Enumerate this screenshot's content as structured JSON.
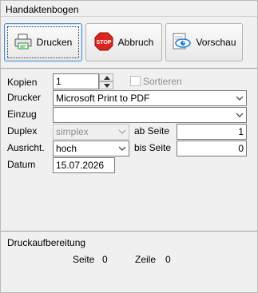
{
  "window": {
    "title": "Handaktenbogen"
  },
  "toolbar": {
    "print_label": "Drucken",
    "abort_label": "Abbruch",
    "stop_text": "STOP",
    "preview_label": "Vorschau"
  },
  "form": {
    "copies_label": "Kopien",
    "copies_value": "1",
    "sort_label": "Sortieren",
    "printer_label": "Drucker",
    "printer_value": "Microsoft Print to PDF",
    "tray_label": "Einzug",
    "tray_value": "",
    "duplex_label": "Duplex",
    "duplex_value": "simplex",
    "from_page_label": "ab Seite",
    "from_page_value": "1",
    "orientation_label": "Ausricht.",
    "orientation_value": "hoch",
    "to_page_label": "bis Seite",
    "to_page_value": "0",
    "date_label": "Datum",
    "date_value": "15.07.2026"
  },
  "status": {
    "heading": "Druckaufbereitung",
    "page_label": "Seite",
    "page_value": "0",
    "line_label": "Zeile",
    "line_value": "0"
  },
  "colors": {
    "accent_focus": "#4a8fd6",
    "stop_red": "#d9251d",
    "preview_blue": "#1f7fd4",
    "print_green": "#3ea04a"
  }
}
